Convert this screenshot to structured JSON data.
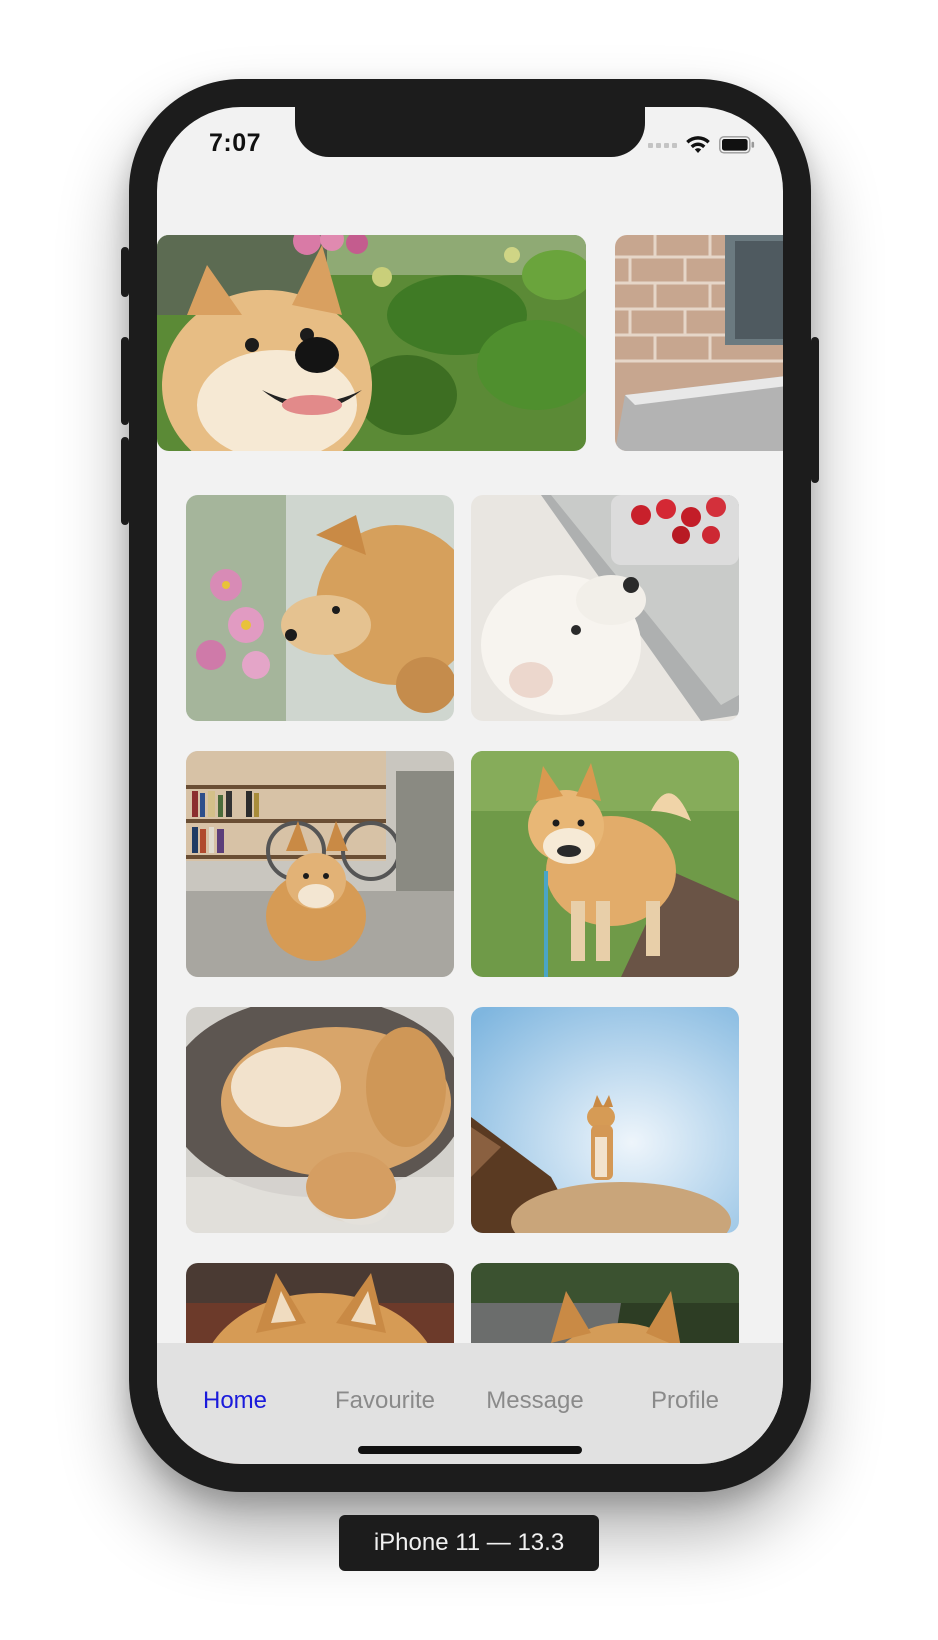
{
  "status_bar": {
    "time": "7:07",
    "icons": [
      "cellular-signal-icon",
      "wifi-icon",
      "battery-icon"
    ]
  },
  "carousel": {
    "images": [
      "shiba-smiling-by-hydrangea",
      "brick-wall-corner"
    ]
  },
  "grid": {
    "images": [
      "shiba-puppy-sniffing-flowers",
      "white-shiba-sniffing-strawberries",
      "shiba-lying-by-bookshelf-bicycle",
      "shiba-standing-on-grass-path",
      "shiba-sleeping-curled-on-cushion",
      "shiba-standing-on-rock-blue-sky",
      "shiba-ears-closeup",
      "shiba-ears-garden"
    ]
  },
  "tabbar": {
    "tabs": [
      {
        "label": "Home",
        "active": true
      },
      {
        "label": "Favourite",
        "active": false
      },
      {
        "label": "Message",
        "active": false
      },
      {
        "label": "Profile",
        "active": false
      }
    ]
  },
  "device_label": "iPhone 11 — 13.3",
  "colors": {
    "active_tab": "#1a1adb",
    "inactive_tab": "#8a8a8a",
    "screen_bg": "#f2f2f2",
    "tabbar_bg": "#e1e1e1",
    "frame": "#1c1c1c"
  }
}
